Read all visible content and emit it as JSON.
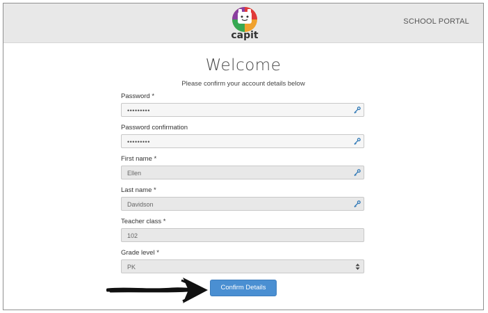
{
  "header": {
    "logo_text": "capit",
    "portal_link": "SCHOOL PORTAL"
  },
  "main": {
    "title": "Welcome",
    "subtitle": "Please confirm your account details below"
  },
  "form": {
    "password": {
      "label": "Password *",
      "value": "•••••••••",
      "icon": "key-icon"
    },
    "password_confirmation": {
      "label": "Password confirmation",
      "value": "•••••••••",
      "icon": "key-icon"
    },
    "first_name": {
      "label": "First name *",
      "value": "Ellen",
      "icon": "key-icon"
    },
    "last_name": {
      "label": "Last name *",
      "value": "Davidson",
      "icon": "key-icon"
    },
    "teacher_class": {
      "label": "Teacher class *",
      "value": "102"
    },
    "grade_level": {
      "label": "Grade level *",
      "value": "PK"
    },
    "submit_label": "Confirm Details"
  },
  "colors": {
    "header_bg": "#e8e8e8",
    "button_bg": "#4a8fd2",
    "key_icon": "#2f78b6"
  }
}
